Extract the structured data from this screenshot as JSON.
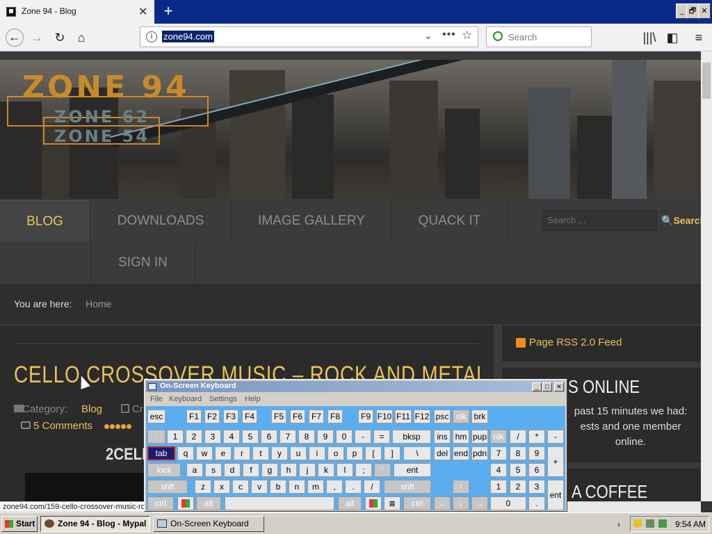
{
  "browser": {
    "tab_title": "Zone 94 - Blog",
    "tab_close": "✕",
    "new_tab": "+",
    "url": "zone94.com",
    "search_placeholder": "Search",
    "window_buttons": [
      "_",
      "🗗",
      "✕"
    ],
    "icons": [
      "back-arrow-icon",
      "forward-arrow-icon",
      "reload-icon",
      "home-icon",
      "site-info-icon",
      "dropdown-chevron-icon",
      "page-actions-icon",
      "bookmark-star-icon",
      "search-engine-icon",
      "library-icon",
      "sidebar-icon",
      "hamburger-menu-icon"
    ]
  },
  "site": {
    "logo": {
      "main": "ZONE 94",
      "sub1": "ZONE 62",
      "sub2": "ZONE 54"
    },
    "menu": {
      "blog": "BLOG",
      "downloads": "DOWNLOADS",
      "gallery": "IMAGE GALLERY",
      "quack": "QUACK IT",
      "signin": "SIGN IN"
    },
    "search_placeholder": "Search ...",
    "search_button": "Search",
    "breadcrumb": {
      "label": "You are here:",
      "home": "Home"
    },
    "article": {
      "title": "CELLO CROSSOVER MUSIC – ROCK AND METAL",
      "category_label": "Category:",
      "category": "Blog",
      "created_label": "Cr",
      "comments": "5 Comments",
      "rating_stars": 5,
      "subheading": "2CELL"
    },
    "sidebar": {
      "rss": "Page RSS 2.0 Feed",
      "online_title": "S ONLINE",
      "online_text": "past 15 minutes we had: ests and one member online.",
      "coffee_title": "A COFFEE"
    },
    "status_url": "zone94.com/159-cello-crossover-music-roc"
  },
  "osk": {
    "title": "On-Screen Keyboard",
    "menu": [
      "File",
      "Keyboard",
      "Settings",
      "Help"
    ],
    "controls": [
      "_",
      "□",
      "✕"
    ]
  },
  "taskbar": {
    "start": "Start",
    "tasks": [
      "Zone 94 - Blog - Mypal",
      "On-Screen Keyboard"
    ],
    "clock": "9:54 AM"
  },
  "colors": {
    "accent": "#e8c35a",
    "titlebar": "#0a2a8a",
    "osk_bg": "#5aaef0"
  }
}
